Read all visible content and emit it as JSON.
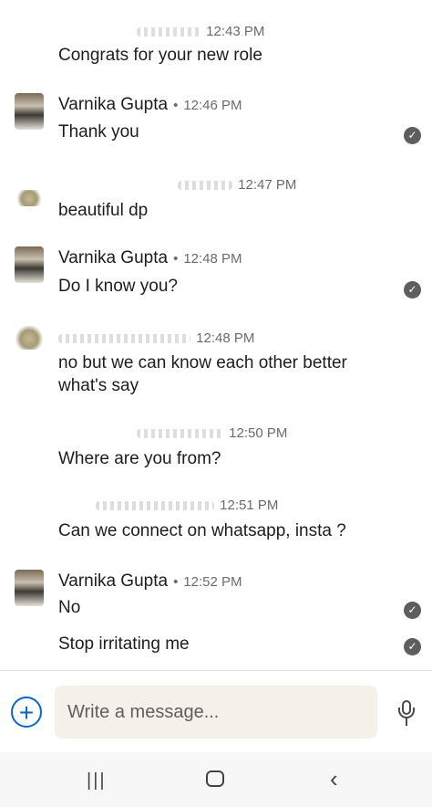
{
  "messages": [
    {
      "sender": "",
      "time": "12:43 PM",
      "text": "Congrats for your new role",
      "own": false
    },
    {
      "sender": "Varnika Gupta",
      "time": "12:46 PM",
      "text": "Thank you",
      "own": true
    },
    {
      "sender": "",
      "time": "12:47 PM",
      "text": "beautiful dp",
      "own": false
    },
    {
      "sender": "Varnika Gupta",
      "time": "12:48 PM",
      "text": "Do I know you?",
      "own": true
    },
    {
      "sender": "",
      "time": "12:48 PM",
      "text_line1": "no but we can know each other better",
      "text_line2": "what's say",
      "own": false
    },
    {
      "sender": "",
      "time": "12:50 PM",
      "text": "Where are you from?",
      "own": false
    },
    {
      "sender": "",
      "time": "12:51 PM",
      "text": "Can we connect on whatsapp, insta ?",
      "own": false
    },
    {
      "sender": "Varnika Gupta",
      "time": "12:52 PM",
      "text": "No",
      "text2": "Stop irritating me",
      "own": true
    }
  ],
  "composer": {
    "placeholder": "Write a message...",
    "add_icon": "plus-icon",
    "mic_icon": "microphone-icon"
  },
  "navbar": {
    "recents_icon": "recents-icon",
    "home_icon": "home-icon",
    "back_icon": "back-icon"
  },
  "colors": {
    "accent": "#0a66c2",
    "composer_bg": "#f5f1ea",
    "check_bg": "#5e5e5e"
  }
}
